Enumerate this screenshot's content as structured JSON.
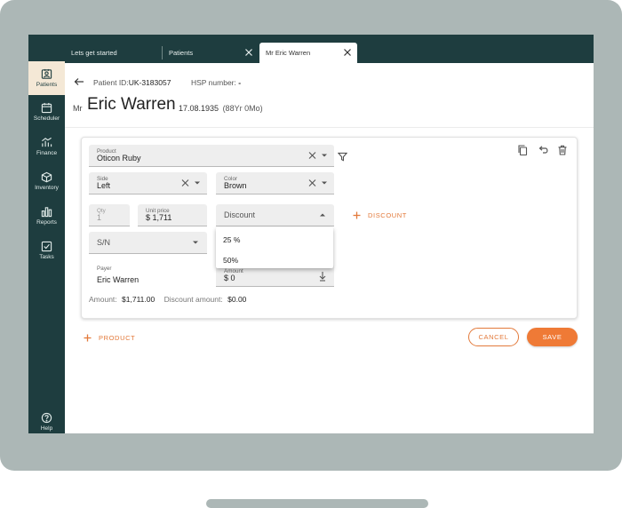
{
  "tabs": [
    {
      "label": "Lets get started",
      "closable": false,
      "active": false
    },
    {
      "label": "Patients",
      "closable": true,
      "active": false
    },
    {
      "label": "Mr Eric Warren",
      "closable": true,
      "active": true
    }
  ],
  "sidebar": {
    "items": [
      {
        "label": "Patients",
        "icon": "patients-icon",
        "active": true
      },
      {
        "label": "Scheduler",
        "icon": "calendar-icon",
        "active": false
      },
      {
        "label": "Finance",
        "icon": "finance-icon",
        "active": false
      },
      {
        "label": "Inventory",
        "icon": "box-icon",
        "active": false
      },
      {
        "label": "Reports",
        "icon": "bar-chart-icon",
        "active": false
      },
      {
        "label": "Tasks",
        "icon": "checkbox-icon",
        "active": false
      }
    ],
    "help_label": "Help"
  },
  "header": {
    "patient_id_label": "Patient ID:",
    "patient_id_value": "UK-3183057",
    "hsp_label": "HSP number:",
    "hsp_value": "-",
    "title_prefix": "Mr",
    "patient_name": "Eric Warren",
    "dob": "17.08.1935",
    "age": "(88Yr 0Mo)"
  },
  "form": {
    "product": {
      "label": "Product",
      "value": "Oticon Ruby"
    },
    "side": {
      "label": "Side",
      "value": "Left"
    },
    "color": {
      "label": "Color",
      "value": "Brown"
    },
    "qty": {
      "label": "Qty",
      "value": "1"
    },
    "unit_price": {
      "label": "Unit price",
      "value": "$ 1,711"
    },
    "discount": {
      "placeholder": "Discount",
      "options": [
        "25 %",
        "50%"
      ]
    },
    "add_discount_label": "DISCOUNT",
    "serial": {
      "placeholder": "S/N"
    },
    "payer": {
      "label": "Payer",
      "value": "Eric Warren"
    },
    "amount_field": {
      "label": "Amount",
      "value": "$ 0"
    },
    "amount_label": "Amount:",
    "amount_value": "$1,711.00",
    "discount_amount_label": "Discount amount:",
    "discount_amount_value": "$0.00"
  },
  "actions": {
    "add_product_label": "PRODUCT",
    "cancel_label": "CANCEL",
    "save_label": "SAVE"
  },
  "colors": {
    "sidebar_bg": "#1e3d3f",
    "accent": "#ef7a36",
    "active_nav_bg": "#f4e8d6"
  }
}
